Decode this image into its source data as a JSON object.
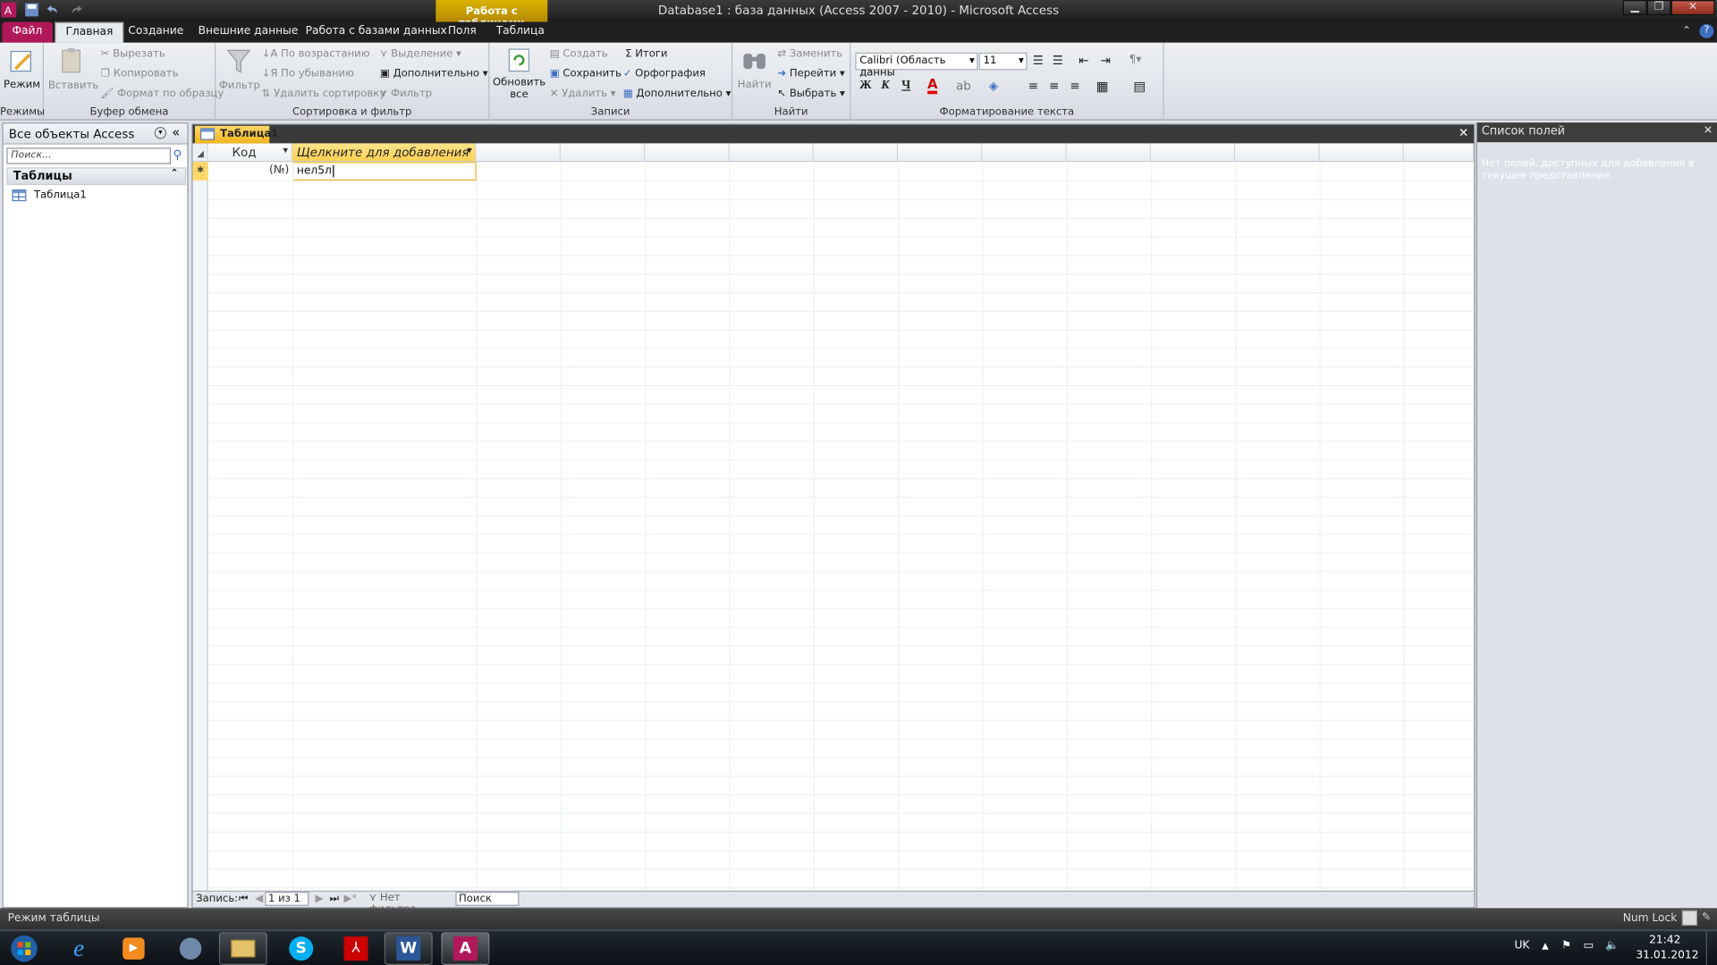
{
  "window": {
    "title": "Database1 : база данных (Access 2007 - 2010)  -  Microsoft Access",
    "context_group": "Работа с таблицами",
    "app_icon": "access-icon"
  },
  "tabs": {
    "file": "Файл",
    "items": [
      "Главная",
      "Создание",
      "Внешние данные",
      "Работа с базами данных",
      "Поля",
      "Таблица"
    ],
    "active": "Главная"
  },
  "ribbon": {
    "views": {
      "label": "Режимы",
      "mode": "Режим"
    },
    "clipboard": {
      "label": "Буфер обмена",
      "paste": "Вставить",
      "cut": "Вырезать",
      "copy": "Копировать",
      "format_painter": "Формат по образцу"
    },
    "sort": {
      "label": "Сортировка и фильтр",
      "filter": "Фильтр",
      "ascending": "По возрастанию",
      "descending": "По убыванию",
      "remove_sort": "Удалить сортировку",
      "selection": "Выделение",
      "advanced": "Дополнительно",
      "toggle_filter": "Фильтр"
    },
    "records": {
      "label": "Записи",
      "refresh": "Обновить",
      "refresh2": "все",
      "new": "Создать",
      "save": "Сохранить",
      "delete": "Удалить",
      "totals": "Итоги",
      "spelling": "Орфография",
      "more": "Дополнительно"
    },
    "find": {
      "label": "Найти",
      "find": "Найти",
      "replace": "Заменить",
      "goto": "Перейти",
      "select": "Выбрать"
    },
    "text": {
      "label": "Форматирование текста",
      "font": "Calibri (Область данны",
      "size": "11",
      "bold": "Ж",
      "italic": "К",
      "underline": "Ч"
    }
  },
  "nav": {
    "title": "Все объекты Access",
    "search_placeholder": "Поиск...",
    "category": "Таблицы",
    "items": [
      "Таблица1"
    ]
  },
  "document": {
    "tab": "Таблица1",
    "col_id": "Код",
    "col_add": "Щелкните для добавления",
    "new_row_marker": "*",
    "autonumber": "(№)",
    "editing_value": "нел5л",
    "record_label": "Запись:",
    "record_pos": "1 из 1",
    "no_filter": "Нет фильтра",
    "search": "Поиск"
  },
  "field_list": {
    "title": "Список полей",
    "message": "Нет полей, доступных для добавления в текущее представление."
  },
  "status": {
    "mode": "Режим таблицы",
    "numlock": "Num Lock"
  },
  "taskbar": {
    "lang": "UK",
    "time": "21:42",
    "date": "31.01.2012"
  },
  "colors": {
    "file_tab": "#b0185a",
    "context": "#d9b100",
    "active_header": "#ffd86a"
  }
}
